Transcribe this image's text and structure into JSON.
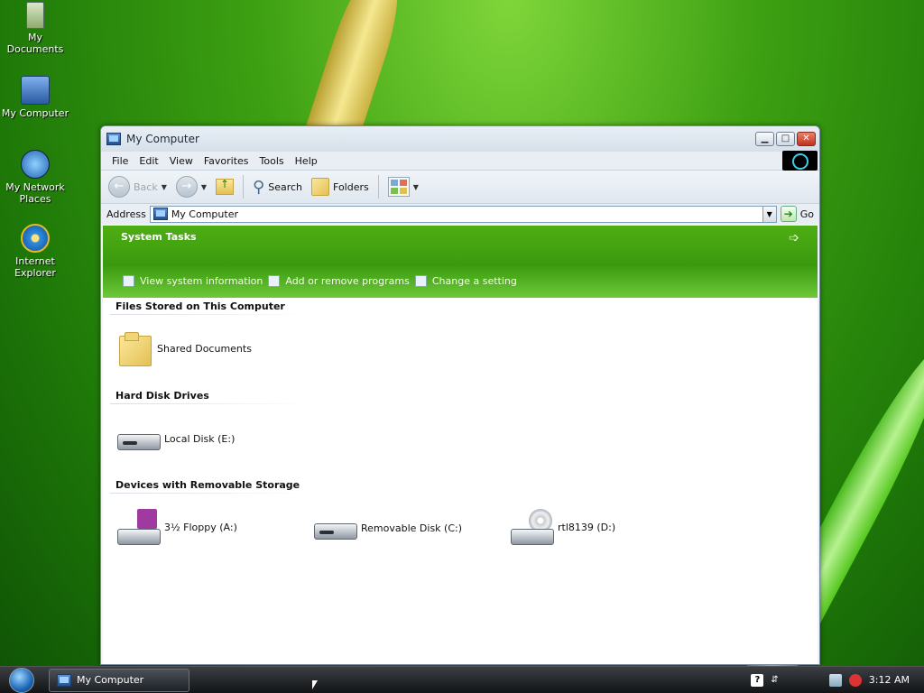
{
  "desktop": {
    "icons": [
      {
        "label": "My Documents"
      },
      {
        "label": "My Computer"
      },
      {
        "label": "My Network Places"
      },
      {
        "label": "Internet Explorer"
      }
    ]
  },
  "window": {
    "title": "My Computer",
    "menu": [
      "File",
      "Edit",
      "View",
      "Favorites",
      "Tools",
      "Help"
    ],
    "toolbar": {
      "back_label": "Back",
      "search_label": "Search",
      "folders_label": "Folders"
    },
    "address": {
      "label": "Address",
      "value": "My Computer",
      "go_label": "Go"
    },
    "system_tasks": {
      "header": "System Tasks",
      "links": [
        "View system information",
        "Add or remove programs",
        "Change a setting"
      ]
    },
    "sections": [
      {
        "title": "Files Stored on This Computer",
        "items": [
          "Shared Documents"
        ]
      },
      {
        "title": "Hard Disk Drives",
        "items": [
          "Local Disk (E:)"
        ]
      },
      {
        "title": "Devices with Removable Storage",
        "items": [
          "3½ Floppy (A:)",
          "Removable Disk (C:)",
          "rtl8139 (D:)"
        ]
      }
    ]
  },
  "taskbar": {
    "task_button": "My Computer",
    "clock": "3:12 AM"
  },
  "colors": {
    "accent": "#3a9a0e",
    "desktop": "#2f8f0e"
  }
}
